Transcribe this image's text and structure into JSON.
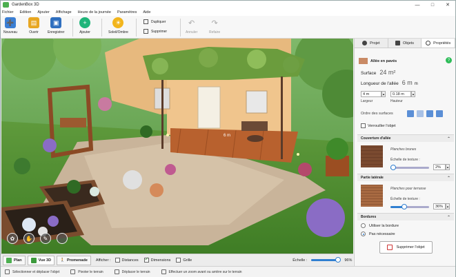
{
  "window": {
    "title": "GardenBox 3D"
  },
  "menu": [
    "Fichier",
    "Edition",
    "Ajouter",
    "Affichage",
    "Heure de la journée",
    "Paramètres",
    "Aide"
  ],
  "toolbar": {
    "nouveau": "Nouveau",
    "ouvrir": "Ouvrir",
    "enregistrer": "Enregistrer",
    "ajouter": "Ajouter",
    "soleil": "Soleil/Ombre",
    "dupliquer": "Dupliquer",
    "supprimer": "Supprimer",
    "annuler": "Annuler",
    "refaire": "Refaire"
  },
  "viewport": {
    "dimension_label": "6 m"
  },
  "viewbar": {
    "plan": "Plan",
    "vue3d": "Vue 3D",
    "promenade": "Promenade",
    "afficher": "Afficher :",
    "distances": "Distances",
    "dimensions": "Dimensions",
    "grille": "Grille",
    "distances_checked": false,
    "dimensions_checked": true,
    "grille_checked": false,
    "echelle_label": "Échelle :",
    "echelle_value": "96%",
    "echelle_level": 0.96
  },
  "status": {
    "select": "Sélectionner et déplacer l'objet",
    "pivoter": "Pivoter le terrain",
    "deplacer": "Déplacer le terrain",
    "zoom": "Effectuer un zoom avant ou arrière sur le terrain"
  },
  "panel": {
    "tabs": [
      "Projet",
      "Objets",
      "Propriétés"
    ],
    "object_name": "Allée en pavés",
    "help": "?",
    "surface_label": "Surface",
    "surface_value": "24 m²",
    "longueur_label": "Longueur de l'allée",
    "longueur_value": "6 m",
    "longueur_unit": "m",
    "largeur_value": "4 m",
    "hauteur_value": "0.18 m",
    "largeur_label": "Largeur",
    "hauteur_label": "Hauteur",
    "ordre_label": "Ordre des surfaces",
    "verrouiller": "Verrouiller l'objet",
    "couverture_head": "Couverture d'allée",
    "couverture_material": "Planches brunes",
    "couverture_scale_label": "Échelle de texture :",
    "couverture_scale_value": "2%",
    "couverture_scale_level": 0.02,
    "laterale_head": "Partie latérale",
    "laterale_material": "Planches pour terrasse",
    "laterale_scale_label": "Échelle de texture :",
    "laterale_scale_value": "36%",
    "laterale_scale_level": 0.36,
    "bordures_head": "Bordures",
    "utiliser_bordure": "Utiliser la bordure",
    "pas_necessaire": "Pas nécessaire",
    "delete_button": "Supprimer l'objet"
  }
}
